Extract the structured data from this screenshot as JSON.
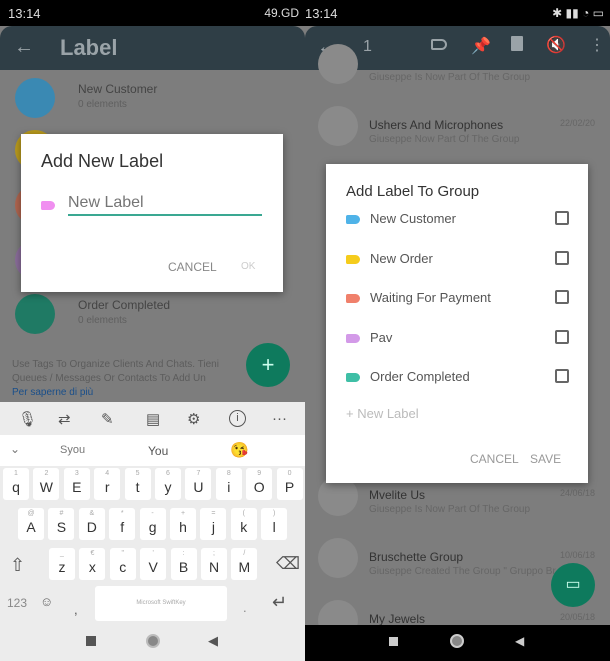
{
  "left": {
    "status": {
      "time": "13:14",
      "right": "49.GD"
    },
    "appbar": {
      "title": "Label"
    },
    "labels": [
      {
        "name": "New Customer",
        "count": "0 elements",
        "color": "#3a89b3"
      },
      {
        "name": "Order Completed",
        "count": "0 elements",
        "color": "#1f7a64"
      }
    ],
    "hidden_avatar_colors": [
      "#b89a1d",
      "#b0654f",
      "#8a6d9a"
    ],
    "footer": {
      "text": "Use Tags To Organize Clients And Chats. Tieni Queues / Messages Or Contacts To Add Un",
      "link": "Per saperne di più"
    },
    "dialog": {
      "title": "Add New Label",
      "placeholder": "New Label",
      "tag_color": "#f08ff0",
      "cancel": "CANCEL",
      "ok": "OK"
    },
    "keyboard": {
      "toolbar": [
        "mic-icon",
        "translate-icon",
        "pen-icon",
        "clipboard-icon",
        "gear-icon",
        "info-icon",
        "more-icon"
      ],
      "suggestions": [
        "Syou",
        "You",
        "😘"
      ],
      "row1": [
        [
          "1",
          "q"
        ],
        [
          "2",
          "W"
        ],
        [
          "3",
          "E"
        ],
        [
          "4",
          "r"
        ],
        [
          "5",
          "t"
        ],
        [
          "6",
          "y"
        ],
        [
          "7",
          "U"
        ],
        [
          "8",
          "i"
        ],
        [
          "9",
          "O"
        ],
        [
          "0",
          "P"
        ]
      ],
      "row2": [
        [
          "@",
          "A"
        ],
        [
          "#",
          "S"
        ],
        [
          "&",
          "D"
        ],
        [
          "*",
          "f"
        ],
        [
          "-",
          "g"
        ],
        [
          "+",
          "h"
        ],
        [
          "=",
          "j"
        ],
        [
          "(",
          "k"
        ],
        [
          ")",
          "l"
        ]
      ],
      "row3": [
        [
          "_",
          "z"
        ],
        [
          "€",
          "x"
        ],
        [
          "\"",
          "c"
        ],
        [
          "'",
          "V"
        ],
        [
          ":",
          "B"
        ],
        [
          ";",
          "N"
        ],
        [
          "/",
          "M"
        ]
      ],
      "num_key": "123",
      "space_label": "Microsoft SwiftKey",
      "comma": ",",
      "period": "."
    }
  },
  "right": {
    "status": {
      "time": "13:14"
    },
    "appbar": {
      "count": "1"
    },
    "chats": [
      {
        "title": "",
        "sub": "Giuseppe Is Now Part Of The Group",
        "date": ""
      },
      {
        "title": "Ushers And Microphones",
        "sub": "Giuseppe Now Part Of The Group",
        "date": "22/02/20"
      },
      {
        "title": "Mvelite Us",
        "sub": "Giuseppe Is Now Part Of The Group",
        "date": "24/06/18"
      },
      {
        "title": "Bruschette Group",
        "sub": "Giuseppe Created The Group \" Gruppo Br",
        "date": "10/06/18"
      },
      {
        "title": "My Jewels",
        "sub": "",
        "date": "20/05/18"
      }
    ],
    "dialog": {
      "title": "Add Label To Group",
      "labels": [
        {
          "name": "New Customer",
          "color": "#4fb3e8",
          "checked": false
        },
        {
          "name": "New Order",
          "color": "#f5cc1c",
          "checked": false
        },
        {
          "name": "Waiting For Payment",
          "color": "#f0806b",
          "checked": false
        },
        {
          "name": "Pav",
          "color": "#d39ae8",
          "checked": false
        },
        {
          "name": "Order Completed",
          "color": "#3fbfa6",
          "checked": false
        }
      ],
      "new_label": "+ New Label",
      "cancel": "CANCEL",
      "save": "SAVE"
    }
  }
}
